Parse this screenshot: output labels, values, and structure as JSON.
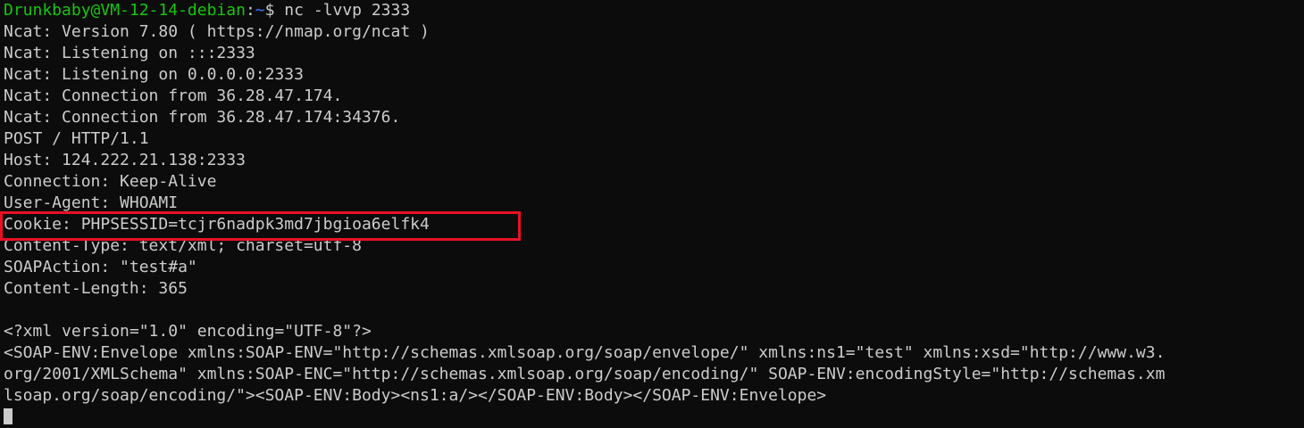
{
  "terminal": {
    "prompt": {
      "user_host": "Drunkbaby@VM-12-14-debian",
      "separator": ":",
      "path": "~",
      "symbol": "$",
      "command": " nc -lvvp 2333"
    },
    "lines": [
      "Ncat: Version 7.80 ( https://nmap.org/ncat )",
      "Ncat: Listening on :::2333",
      "Ncat: Listening on 0.0.0.0:2333",
      "Ncat: Connection from 36.28.47.174.",
      "Ncat: Connection from 36.28.47.174:34376.",
      "POST / HTTP/1.1",
      "Host: 124.222.21.138:2333",
      "Connection: Keep-Alive",
      "User-Agent: WHOAMI",
      "Cookie: PHPSESSID=tcjr6nadpk3md7jbgioa6elfk4",
      "Content-Type: text/xml; charset=utf-8",
      "SOAPAction: \"test#a\"",
      "Content-Length: 365",
      "",
      "<?xml version=\"1.0\" encoding=\"UTF-8\"?>",
      "<SOAP-ENV:Envelope xmlns:SOAP-ENV=\"http://schemas.xmlsoap.org/soap/envelope/\" xmlns:ns1=\"test\" xmlns:xsd=\"http://www.w3.",
      "org/2001/XMLSchema\" xmlns:SOAP-ENC=\"http://schemas.xmlsoap.org/soap/encoding/\" SOAP-ENV:encodingStyle=\"http://schemas.xm",
      "lsoap.org/soap/encoding/\"><SOAP-ENV:Body><ns1:a/></SOAP-ENV:Body></SOAP-ENV:Envelope>"
    ]
  },
  "colors": {
    "background": "#0c0c0c",
    "foreground": "#cccccc",
    "prompt_user": "#16c60c",
    "prompt_path": "#3b78ff",
    "highlight_border": "#e81123"
  }
}
